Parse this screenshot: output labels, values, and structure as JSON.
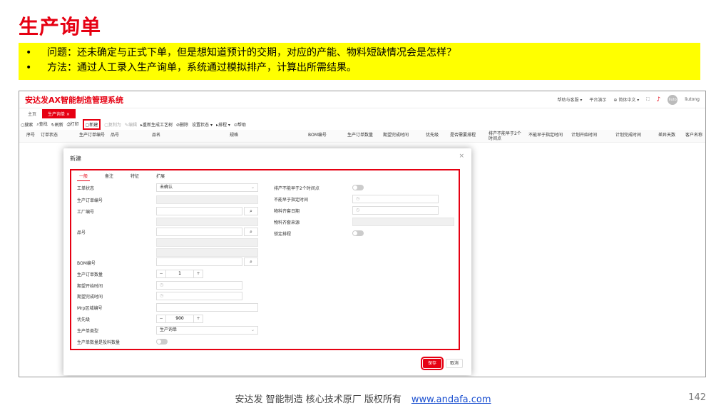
{
  "slide": {
    "title": "生产询单",
    "bullets": [
      {
        "marker": "•",
        "text": "问题：还未确定与正式下单，但是想知道预计的交期，对应的产能、物料短缺情况会是怎样？"
      },
      {
        "marker": "•",
        "text": "方法：通过人工录入生产询单，系统通过模拟排产，计算出所需结果。"
      }
    ],
    "footer_text": "安达发  智能制造 核心技术原厂   版权所有",
    "footer_link": "www.andafa.com",
    "page_number": "142"
  },
  "app": {
    "title": "安达发AX智能制造管理系统",
    "header": {
      "help": "帮助与客服 ▾",
      "platform": "平台演示",
      "language": "简体中文 ▾",
      "user": "liutong",
      "avatar": "liuto"
    },
    "tabs": [
      "主页",
      "生产询单  ×"
    ],
    "toolbar": [
      {
        "label": "搜索",
        "icon": "○"
      },
      {
        "label": "查找",
        "icon": "⌕"
      },
      {
        "label": "刷新",
        "icon": "↻"
      },
      {
        "label": "打印",
        "icon": "⎙"
      },
      {
        "label": "新建",
        "icon": "▢"
      },
      {
        "label": "复制为",
        "icon": "▢"
      },
      {
        "label": "编辑",
        "icon": "✎"
      },
      {
        "label": "重新生成工艺树",
        "icon": "▸"
      },
      {
        "label": "删除",
        "icon": "⊘"
      },
      {
        "label": "设置状态 ▾",
        "icon": ""
      },
      {
        "label": "排程 ▾",
        "icon": "▸"
      },
      {
        "label": "帮助",
        "icon": "⊙"
      }
    ],
    "columns": [
      "序号",
      "订单状态",
      "生产订单编号",
      "品号",
      "品名",
      "规格",
      "BOM编号",
      "生产订单数量",
      "期望完成时间",
      "优先级",
      "是否需要排程",
      "排产不能早于2个时间点",
      "不能早于指定时间",
      "计划开始时间",
      "计划完成时间",
      "差异天数",
      "客户名称"
    ]
  },
  "modal": {
    "title": "新建",
    "close": "×",
    "tabs": [
      "一般",
      "备注",
      "特征",
      "扩展"
    ],
    "left_fields": {
      "order_status": {
        "label": "工单状态",
        "value": "未确认"
      },
      "order_no": {
        "label": "生产订单编号",
        "value": ""
      },
      "factory_no": {
        "label": "工厂编号",
        "value": ""
      },
      "item_no": {
        "label": "品号",
        "value": ""
      },
      "bom_no": {
        "label": "BOM编号",
        "value": ""
      },
      "quantity": {
        "label": "生产订单数量",
        "value": "1"
      },
      "expected_start": {
        "label": "期望开始时间",
        "value": ""
      },
      "expected_finish": {
        "label": "期望完成时间",
        "value": ""
      },
      "mrp_zone": {
        "label": "Mrp区域编号",
        "value": ""
      },
      "priority": {
        "label": "优先级",
        "value": "900"
      },
      "order_type": {
        "label": "生产单类型",
        "value": "生产询单"
      },
      "is_feed_qty": {
        "label": "生产单数量是投料数量",
        "value": ""
      }
    },
    "right_fields": {
      "no_earlier_two": {
        "label": "排产不能早于2个时间点"
      },
      "no_earlier_time": {
        "label": "不能早于指定时间"
      },
      "material_date": {
        "label": "物料齐套日期"
      },
      "material_source": {
        "label": "物料齐套来源"
      },
      "lock_schedule": {
        "label": "锁定排程"
      }
    },
    "save": "保存",
    "cancel": "取消",
    "stepper_minus": "−",
    "stepper_plus": "+",
    "search_glyph": "⌕",
    "clock_glyph": "◷",
    "chevron_glyph": "⌄"
  },
  "colors": {
    "accent": "#e60012",
    "highlight": "#ffff00",
    "link": "#1a4fd0"
  }
}
